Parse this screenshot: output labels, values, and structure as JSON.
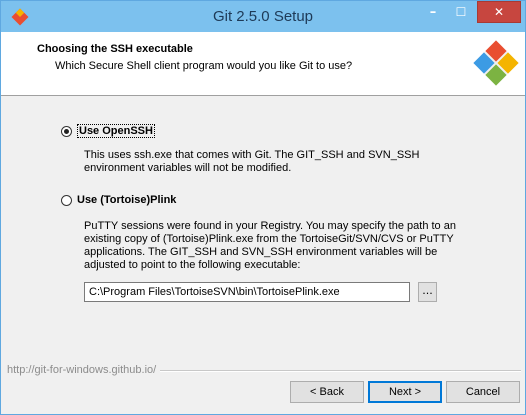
{
  "window": {
    "title": "Git 2.5.0 Setup",
    "minimize_glyph": "–",
    "maximize_glyph": "☐",
    "close_glyph": "✕"
  },
  "header": {
    "title": "Choosing the SSH executable",
    "subtitle": "Which Secure Shell client program would you like Git to use?"
  },
  "options": [
    {
      "label": "Use OpenSSH",
      "selected": true,
      "description": "This uses ssh.exe that comes with Git. The GIT_SSH and SVN_SSH environment variables will not be modified."
    },
    {
      "label": "Use (Tortoise)Plink",
      "selected": false,
      "description": "PuTTY sessions were found in your Registry. You may specify the path to an existing copy of (Tortoise)Plink.exe from the TortoiseGit/SVN/CVS or PuTTY applications. The GIT_SSH and SVN_SSH environment variables will be adjusted to point to the following executable:"
    }
  ],
  "plink_path": {
    "value": "C:\\Program Files\\TortoiseSVN\\bin\\TortoisePlink.exe",
    "browse_label": "..."
  },
  "footer": {
    "url": "http://git-for-windows.github.io/"
  },
  "buttons": {
    "back": "< Back",
    "next": "Next >",
    "cancel": "Cancel"
  },
  "colors": {
    "titlebar": "#7cc1ee",
    "close_button": "#c7463f",
    "git_logo": "#e94e31"
  }
}
